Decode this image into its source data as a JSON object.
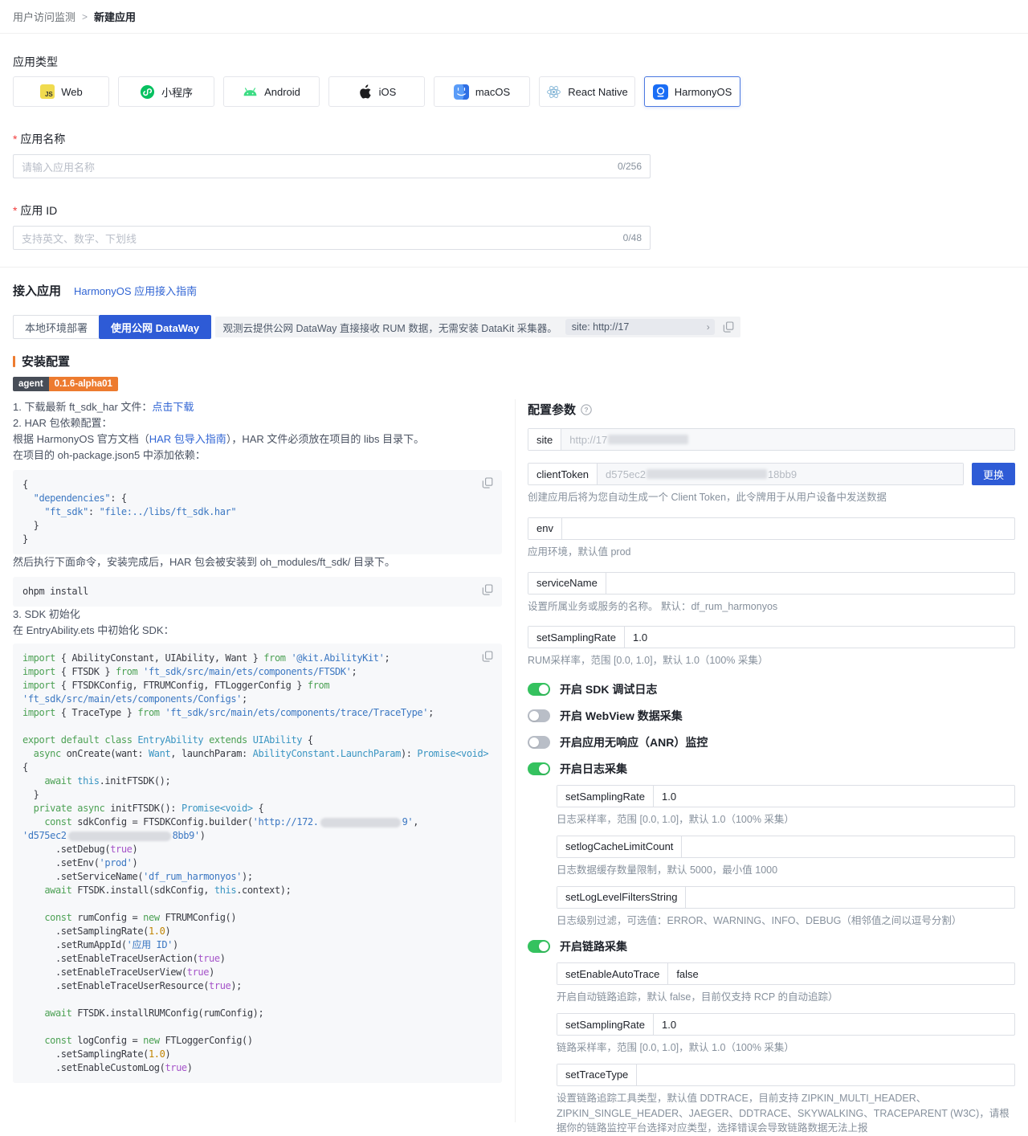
{
  "breadcrumb": {
    "section": "用户访问监测",
    "separator": ">",
    "current": "新建应用"
  },
  "app_type": {
    "label": "应用类型",
    "items": [
      {
        "label": "Web",
        "icon": "js-icon",
        "selected": false
      },
      {
        "label": "小程序",
        "icon": "miniprogram-icon",
        "selected": false
      },
      {
        "label": "Android",
        "icon": "android-icon",
        "selected": false
      },
      {
        "label": "iOS",
        "icon": "apple-icon",
        "selected": false
      },
      {
        "label": "macOS",
        "icon": "finder-icon",
        "selected": false
      },
      {
        "label": "React Native",
        "icon": "react-icon",
        "selected": false
      },
      {
        "label": "HarmonyOS",
        "icon": "harmonyos-icon",
        "selected": true
      }
    ]
  },
  "form": {
    "name": {
      "label": "应用名称",
      "placeholder": "请输入应用名称",
      "counter": "0/256"
    },
    "id": {
      "label": "应用 ID",
      "placeholder": "支持英文、数字、下划线",
      "counter": "0/48"
    }
  },
  "access": {
    "title": "接入应用",
    "guide_link": "HarmonyOS 应用接入指南",
    "tabs": [
      {
        "label": "本地环境部署",
        "active": false
      },
      {
        "label": "使用公网 DataWay",
        "active": true
      }
    ],
    "info_text": "观测云提供公网 DataWay 直接接收 RUM 数据，无需安装 DataKit 采集器。",
    "site_pill": "site: http://17",
    "chevron": "›"
  },
  "install": {
    "title": "安装配置",
    "badge": {
      "name": "agent",
      "version": "0.1.6-alpha01"
    },
    "step1": {
      "text": "1. 下载最新 ft_sdk_har 文件：",
      "link": "点击下载"
    },
    "step2": "2. HAR 包依赖配置：",
    "p_doc": {
      "pre": "根据 HarmonyOS 官方文档（",
      "link": "HAR 包导入指南",
      "post": "），HAR 文件必须放在项目的 libs 目录下。"
    },
    "p_add": "在项目的 oh-package.json5 中添加依赖：",
    "p_then": "然后执行下面命令，安装完成后，HAR 包会被安装到 oh_modules/ft_sdk/ 目录下。",
    "step3": "3. SDK 初始化",
    "p_init": "在 EntryAbility.ets 中初始化 SDK：",
    "code_blocks": [
      {
        "id": "code1",
        "lines": [
          [
            [
              "p",
              "{"
            ]
          ],
          [
            [
              "p",
              "  "
            ],
            [
              "s",
              "\"dependencies\""
            ],
            [
              "p",
              ": {"
            ]
          ],
          [
            [
              "p",
              "    "
            ],
            [
              "s",
              "\"ft_sdk\""
            ],
            [
              "p",
              ": "
            ],
            [
              "s",
              "\"file:../libs/ft_sdk.har\""
            ]
          ],
          [
            [
              "p",
              "  }"
            ]
          ],
          [
            [
              "p",
              "}"
            ]
          ]
        ]
      },
      {
        "id": "code2",
        "lines": [
          [
            [
              "p",
              "ohpm install"
            ]
          ]
        ]
      },
      {
        "id": "code3",
        "lines": [
          [
            [
              "k",
              "import"
            ],
            [
              "p",
              " { AbilityConstant, UIAbility, Want } "
            ],
            [
              "k",
              "from"
            ],
            [
              "p",
              " "
            ],
            [
              "s",
              "'@kit.AbilityKit'"
            ],
            [
              "p",
              ";"
            ]
          ],
          [
            [
              "k",
              "import"
            ],
            [
              "p",
              " { FTSDK } "
            ],
            [
              "k",
              "from"
            ],
            [
              "p",
              " "
            ],
            [
              "s",
              "'ft_sdk/src/main/ets/components/FTSDK'"
            ],
            [
              "p",
              ";"
            ]
          ],
          [
            [
              "k",
              "import"
            ],
            [
              "p",
              " { FTSDKConfig, FTRUMConfig, FTLoggerConfig } "
            ],
            [
              "k",
              "from"
            ]
          ],
          [
            [
              "s",
              "'ft_sdk/src/main/ets/components/Configs'"
            ],
            [
              "p",
              ";"
            ]
          ],
          [
            [
              "k",
              "import"
            ],
            [
              "p",
              " { TraceType } "
            ],
            [
              "k",
              "from"
            ],
            [
              "p",
              " "
            ],
            [
              "s",
              "'ft_sdk/src/main/ets/components/trace/TraceType'"
            ],
            [
              "p",
              ";"
            ]
          ],
          [],
          [
            [
              "k",
              "export"
            ],
            [
              "p",
              " "
            ],
            [
              "k",
              "default"
            ],
            [
              "p",
              " "
            ],
            [
              "k",
              "class"
            ],
            [
              "p",
              " "
            ],
            [
              "t",
              "EntryAbility"
            ],
            [
              "p",
              " "
            ],
            [
              "k",
              "extends"
            ],
            [
              "p",
              " "
            ],
            [
              "t",
              "UIAbility"
            ],
            [
              "p",
              " {"
            ]
          ],
          [
            [
              "p",
              "  "
            ],
            [
              "k",
              "async"
            ],
            [
              "p",
              " onCreate(want: "
            ],
            [
              "t",
              "Want"
            ],
            [
              "p",
              ", launchParam: "
            ],
            [
              "t",
              "AbilityConstant.LaunchParam"
            ],
            [
              "p",
              "): "
            ],
            [
              "t",
              "Promise<void>"
            ]
          ],
          [
            [
              "p",
              "{"
            ]
          ],
          [
            [
              "p",
              "    "
            ],
            [
              "k",
              "await"
            ],
            [
              "p",
              " "
            ],
            [
              "t",
              "this"
            ],
            [
              "p",
              ".initFTSDK();"
            ]
          ],
          [
            [
              "p",
              "  }"
            ]
          ],
          [
            [
              "p",
              "  "
            ],
            [
              "k",
              "private"
            ],
            [
              "p",
              " "
            ],
            [
              "k",
              "async"
            ],
            [
              "p",
              " initFTSDK(): "
            ],
            [
              "t",
              "Promise<void>"
            ],
            [
              "p",
              " {"
            ]
          ],
          [
            [
              "p",
              "    "
            ],
            [
              "k",
              "const"
            ],
            [
              "p",
              " sdkConfig = FTSDKConfig.builder("
            ],
            [
              "s",
              "'http://172."
            ],
            [
              "x",
              "100"
            ],
            [
              "s",
              "9'"
            ],
            [
              "p",
              ","
            ]
          ],
          [
            [
              "s",
              "'d575ec2"
            ],
            [
              "x",
              "128"
            ],
            [
              "s",
              "8bb9'"
            ],
            [
              "p",
              ")"
            ]
          ],
          [
            [
              "p",
              "      .setDebug("
            ],
            [
              "b",
              "true"
            ],
            [
              "p",
              ")"
            ]
          ],
          [
            [
              "p",
              "      .setEnv("
            ],
            [
              "s",
              "'prod'"
            ],
            [
              "p",
              ")"
            ]
          ],
          [
            [
              "p",
              "      .setServiceName("
            ],
            [
              "s",
              "'df_rum_harmonyos'"
            ],
            [
              "p",
              ");"
            ]
          ],
          [
            [
              "p",
              "    "
            ],
            [
              "k",
              "await"
            ],
            [
              "p",
              " FTSDK.install(sdkConfig, "
            ],
            [
              "t",
              "this"
            ],
            [
              "p",
              ".context);"
            ]
          ],
          [],
          [
            [
              "p",
              "    "
            ],
            [
              "k",
              "const"
            ],
            [
              "p",
              " rumConfig = "
            ],
            [
              "k",
              "new"
            ],
            [
              "p",
              " FTRUMConfig()"
            ]
          ],
          [
            [
              "p",
              "      .setSamplingRate("
            ],
            [
              "n",
              "1.0"
            ],
            [
              "p",
              ")"
            ]
          ],
          [
            [
              "p",
              "      .setRumAppId("
            ],
            [
              "s",
              "'应用 ID'"
            ],
            [
              "p",
              ")"
            ]
          ],
          [
            [
              "p",
              "      .setEnableTraceUserAction("
            ],
            [
              "b",
              "true"
            ],
            [
              "p",
              ")"
            ]
          ],
          [
            [
              "p",
              "      .setEnableTraceUserView("
            ],
            [
              "b",
              "true"
            ],
            [
              "p",
              ")"
            ]
          ],
          [
            [
              "p",
              "      .setEnableTraceUserResource("
            ],
            [
              "b",
              "true"
            ],
            [
              "p",
              ");"
            ]
          ],
          [],
          [
            [
              "p",
              "    "
            ],
            [
              "k",
              "await"
            ],
            [
              "p",
              " FTSDK.installRUMConfig(rumConfig);"
            ]
          ],
          [],
          [
            [
              "p",
              "    "
            ],
            [
              "k",
              "const"
            ],
            [
              "p",
              " logConfig = "
            ],
            [
              "k",
              "new"
            ],
            [
              "p",
              " FTLoggerConfig()"
            ]
          ],
          [
            [
              "p",
              "      .setSamplingRate("
            ],
            [
              "n",
              "1.0"
            ],
            [
              "p",
              ")"
            ]
          ],
          [
            [
              "p",
              "      .setEnableCustomLog("
            ],
            [
              "b",
              "true"
            ],
            [
              "p",
              ")"
            ]
          ]
        ]
      }
    ]
  },
  "params": {
    "title": "配置参数",
    "items": [
      {
        "type": "field",
        "label": "site",
        "prefix": "http://17",
        "blur": 100,
        "suffix": "",
        "disabled": true
      },
      {
        "type": "field",
        "label": "clientToken",
        "prefix": "d575ec2",
        "blur": 150,
        "suffix": "18bb9",
        "disabled": true,
        "action": "更换"
      },
      {
        "type": "caption",
        "text": "创建应用后将为您自动生成一个 Client Token，此令牌用于从用户设备中发送数据"
      },
      {
        "type": "field",
        "label": "env"
      },
      {
        "type": "caption",
        "text": "应用环境，默认值 prod"
      },
      {
        "type": "field",
        "label": "serviceName"
      },
      {
        "type": "caption",
        "text": "设置所属业务或服务的名称。 默认：df_rum_harmonyos"
      },
      {
        "type": "field",
        "label": "setSamplingRate",
        "value": "1.0"
      },
      {
        "type": "caption",
        "text": "RUM采样率，范围 [0.0, 1.0]，默认 1.0（100% 采集）"
      },
      {
        "type": "toggle",
        "label": "开启 SDK 调试日志",
        "on": true
      },
      {
        "type": "toggle",
        "label": "开启 WebView 数据采集",
        "on": false
      },
      {
        "type": "toggle",
        "label": "开启应用无响应（ANR）监控",
        "on": false
      },
      {
        "type": "toggle",
        "label": "开启日志采集",
        "on": true
      },
      {
        "type": "group",
        "items": [
          {
            "type": "field",
            "label": "setSamplingRate",
            "value": "1.0"
          },
          {
            "type": "caption",
            "text": "日志采样率，范围 [0.0, 1.0]，默认 1.0（100% 采集）"
          },
          {
            "type": "field",
            "label": "setlogCacheLimitCount"
          },
          {
            "type": "caption",
            "text": "日志数据缓存数量限制，默认 5000，最小值 1000"
          },
          {
            "type": "field",
            "label": "setLogLevelFiltersString"
          },
          {
            "type": "caption",
            "text": "日志级别过滤，可选值：ERROR、WARNING、INFO、DEBUG（相邻值之间以逗号分割）"
          }
        ]
      },
      {
        "type": "toggle",
        "label": "开启链路采集",
        "on": true
      },
      {
        "type": "group",
        "items": [
          {
            "type": "field",
            "label": "setEnableAutoTrace",
            "value": "false"
          },
          {
            "type": "caption",
            "text": "开启自动链路追踪，默认 false，目前仅支持 RCP 的自动追踪）"
          },
          {
            "type": "field",
            "label": "setSamplingRate",
            "value": "1.0"
          },
          {
            "type": "caption",
            "text": "链路采样率，范围 [0.0, 1.0]，默认 1.0（100% 采集）"
          },
          {
            "type": "field",
            "label": "setTraceType"
          },
          {
            "type": "caption",
            "text": "设置链路追踪工具类型，默认值 DDTRACE，目前支持 ZIPKIN_MULTI_HEADER、ZIPKIN_SINGLE_HEADER、JAEGER、DDTRACE、SKYWALKING、TRACEPARENT (W3C)，请根据你的链路监控平台选择对应类型，选择错误会导致链路数据无法上报"
          }
        ]
      }
    ]
  }
}
